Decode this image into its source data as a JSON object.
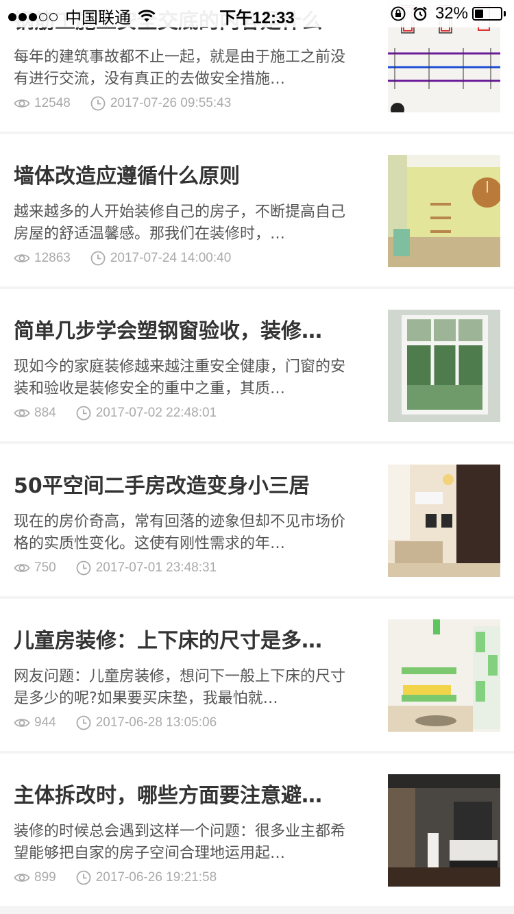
{
  "status_bar": {
    "carrier": "中国联通",
    "time": "下午12:33",
    "battery": "32%",
    "battery_level": 0.32,
    "signal_bars": 3,
    "signal_total": 5
  },
  "articles": [
    {
      "title": "钢筋工施工安全交底的内容是什么",
      "summary": "每年的建筑事故都不止一起，就是由于施工之前没有进行交流，没有真正的去做安全措施…",
      "views": "12548",
      "datetime": "2017-07-26 09:55:43",
      "thumb": "rebar-drawing"
    },
    {
      "title": "墙体改造应遵循什么原则",
      "summary": "越来越多的人开始装修自己的房子，不断提高自己房屋的舒适温馨感。那我们在装修时，…",
      "views": "12863",
      "datetime": "2017-07-24 14:00:40",
      "thumb": "green-wall"
    },
    {
      "title": "简单几步学会塑钢窗验收，装修…",
      "summary": "现如今的家庭装修越来越注重安全健康，门窗的安装和验收是装修安全的重中之重，其质…",
      "views": "884",
      "datetime": "2017-07-02 22:48:01",
      "thumb": "window"
    },
    {
      "title": "50平空间二手房改造变身小三居",
      "summary": "现在的房价奇高，常有回落的迹象但却不见市场价格的实质性变化。这使有刚性需求的年…",
      "views": "750",
      "datetime": "2017-07-01 23:48:31",
      "thumb": "living-room"
    },
    {
      "title": "儿童房装修：上下床的尺寸是多…",
      "summary": "网友问题：儿童房装修，想问下一般上下床的尺寸是多少的呢?如果要买床垫，我最怕就…",
      "views": "944",
      "datetime": "2017-06-28 13:05:06",
      "thumb": "kids-room"
    },
    {
      "title": "主体拆改时，哪些方面要注意避…",
      "summary": "装修的时候总会遇到这样一个问题：很多业主都希望能够把自家的房子空间合理地运用起…",
      "views": "899",
      "datetime": "2017-06-26 19:21:58",
      "thumb": "bedroom"
    }
  ]
}
